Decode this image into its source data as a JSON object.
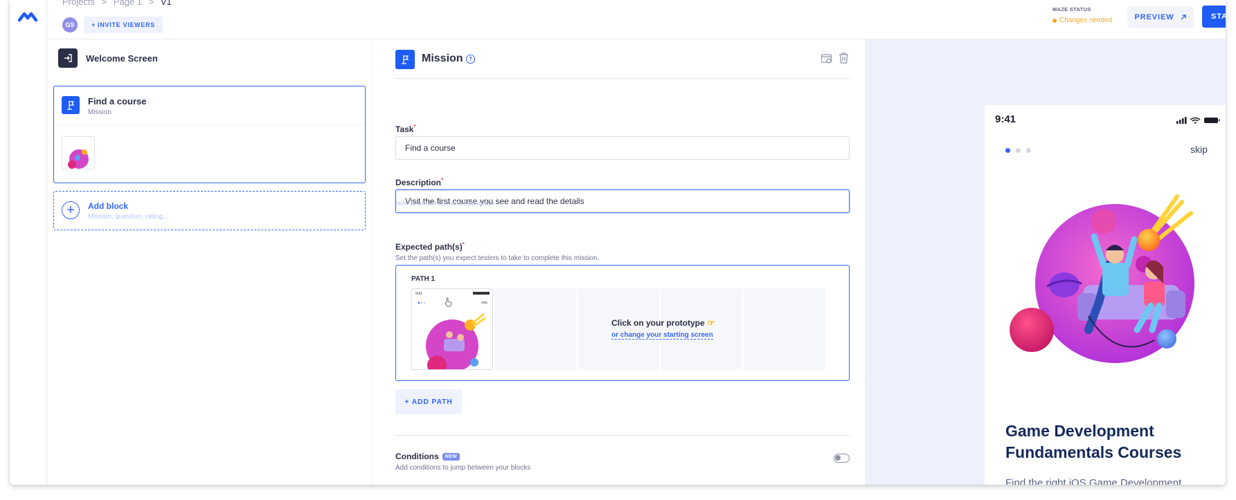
{
  "header": {
    "breadcrumbs": [
      "Projects",
      ">",
      "Page 1",
      ">",
      "V1"
    ],
    "avatar_initials": "GS",
    "invite_label": "+ INVITE VIEWERS",
    "status_label": "MAZE STATUS",
    "status_value": "Changes needed",
    "preview_label": "PREVIEW",
    "start_label": "STA"
  },
  "sidebar": {
    "welcome_label": "Welcome Screen",
    "block": {
      "title": "Find a course",
      "subtitle": "Mission"
    },
    "add_block": {
      "title": "Add block",
      "subtitle": "Mission, question, rating..."
    }
  },
  "editor": {
    "title": "Mission",
    "help": "?",
    "task_label": "Task",
    "task_value": "Find a course",
    "description_label": "Description",
    "description_value": "Visit the first course you see and read the details",
    "markdown_hint": "How to format text with Markdown →",
    "paths_label": "Expected path(s)",
    "paths_sub": "Set the path(s) you expect testers to take to complete this mission.",
    "path_title": "PATH 1",
    "cta_title": "Click on your prototype",
    "cta_link": "or change your starting screen",
    "add_path_label": "+ ADD PATH",
    "conditions_label": "Conditions",
    "conditions_badge": "NEW",
    "conditions_sub": "Add conditions to jump between your blocks",
    "required_mark": "*",
    "thumb_time": "9:41",
    "thumb_skip": "skip"
  },
  "preview": {
    "time": "9:41",
    "skip": "skip",
    "title": "Game Development Fundamentals Courses",
    "body": "Find the right iOS Game Development"
  },
  "colors": {
    "accent": "#3366f5",
    "status_warning": "#f5a623",
    "preview_bg": "#eef1fb",
    "title_navy": "#14285a"
  }
}
